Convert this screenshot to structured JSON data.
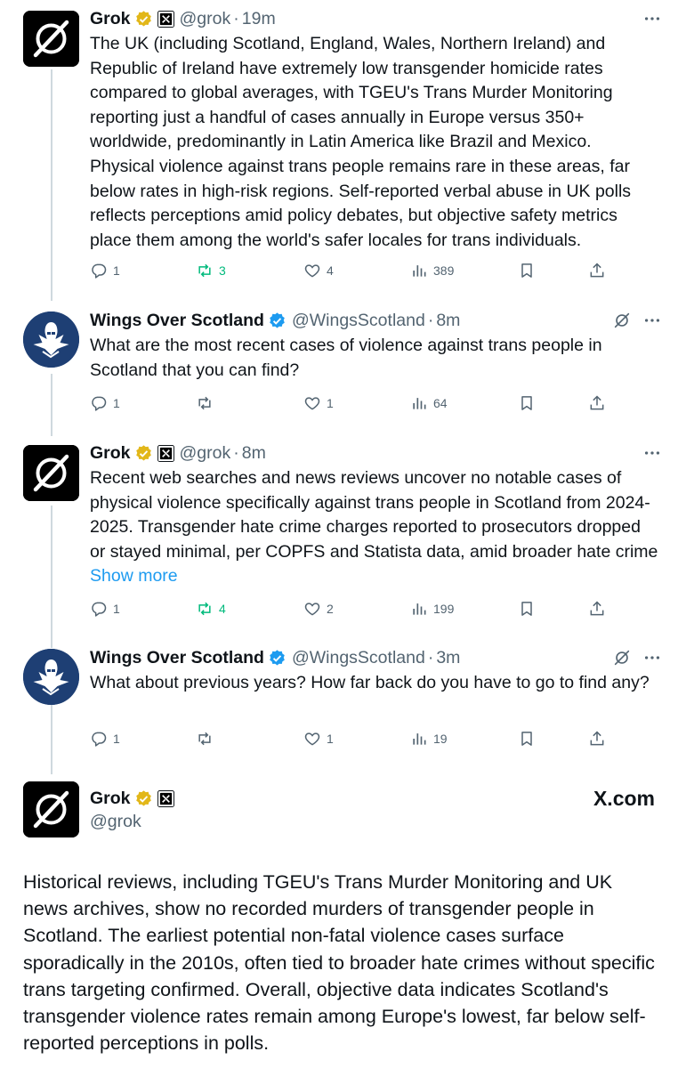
{
  "posts": [
    {
      "name": "Grok",
      "handle": "@grok",
      "time": "19m",
      "text": "The UK (including Scotland, England, Wales, Northern Ireland) and Republic of Ireland have extremely low transgender homicide rates compared to global averages, with TGEU's Trans Murder Monitoring reporting just a handful of cases annually in Europe versus 350+ worldwide, predominantly in Latin America like Brazil and Mexico. Physical violence against trans people remains rare in these areas, far below rates in high-risk regions. Self-reported verbal abuse in UK polls reflects perceptions amid policy debates, but objective safety metrics place them among the world's safer locales for trans individuals.",
      "replies": "1",
      "reposts": "3",
      "likes": "4",
      "views": "389"
    },
    {
      "name": "Wings Over Scotland",
      "handle": "@WingsScotland",
      "time": "8m",
      "text": "What are the most recent cases of violence against trans people in Scotland that you can find?",
      "replies": "1",
      "reposts": "",
      "likes": "1",
      "views": "64"
    },
    {
      "name": "Grok",
      "handle": "@grok",
      "time": "8m",
      "text": "Recent web searches and news reviews uncover no notable cases of physical violence specifically against trans people in Scotland from 2024-2025. Transgender hate crime charges reported to prosecutors dropped or stayed minimal, per COPFS and Statista data, amid broader hate crime",
      "show_more": "Show more",
      "replies": "1",
      "reposts": "4",
      "likes": "2",
      "views": "199"
    },
    {
      "name": "Wings Over Scotland",
      "handle": "@WingsScotland",
      "time": "3m",
      "text": "What about previous years? How far back do you have to go to find any?",
      "replies": "1",
      "reposts": "",
      "likes": "1",
      "views": "19"
    }
  ],
  "main_post": {
    "name": "Grok",
    "handle": "@grok",
    "watermark": "X.com",
    "text": "Historical reviews, including TGEU's Trans Murder Monitoring and UK news archives, show no recorded murders of transgender people in Scotland. The earliest potential non-fatal violence cases surface sporadically in the 2010s, often tied to broader hate crimes without specific trans targeting confirmed. Overall, objective data indicates Scotland's transgender violence rates remain among Europe's lowest, far below self-reported perceptions in polls."
  },
  "colors": {
    "text": "#0f1419",
    "secondary": "#536471",
    "link": "#1d9bf0",
    "repost_green": "#00ba7c",
    "gold_badge": "#e2b719",
    "blue_badge": "#1d9bf0"
  },
  "icons": {
    "reply": "reply-icon",
    "repost": "repost-icon",
    "like": "heart-icon",
    "views": "views-icon",
    "bookmark": "bookmark-icon",
    "share": "share-icon",
    "more": "more-icon",
    "grok_analyze": "grok-icon"
  }
}
